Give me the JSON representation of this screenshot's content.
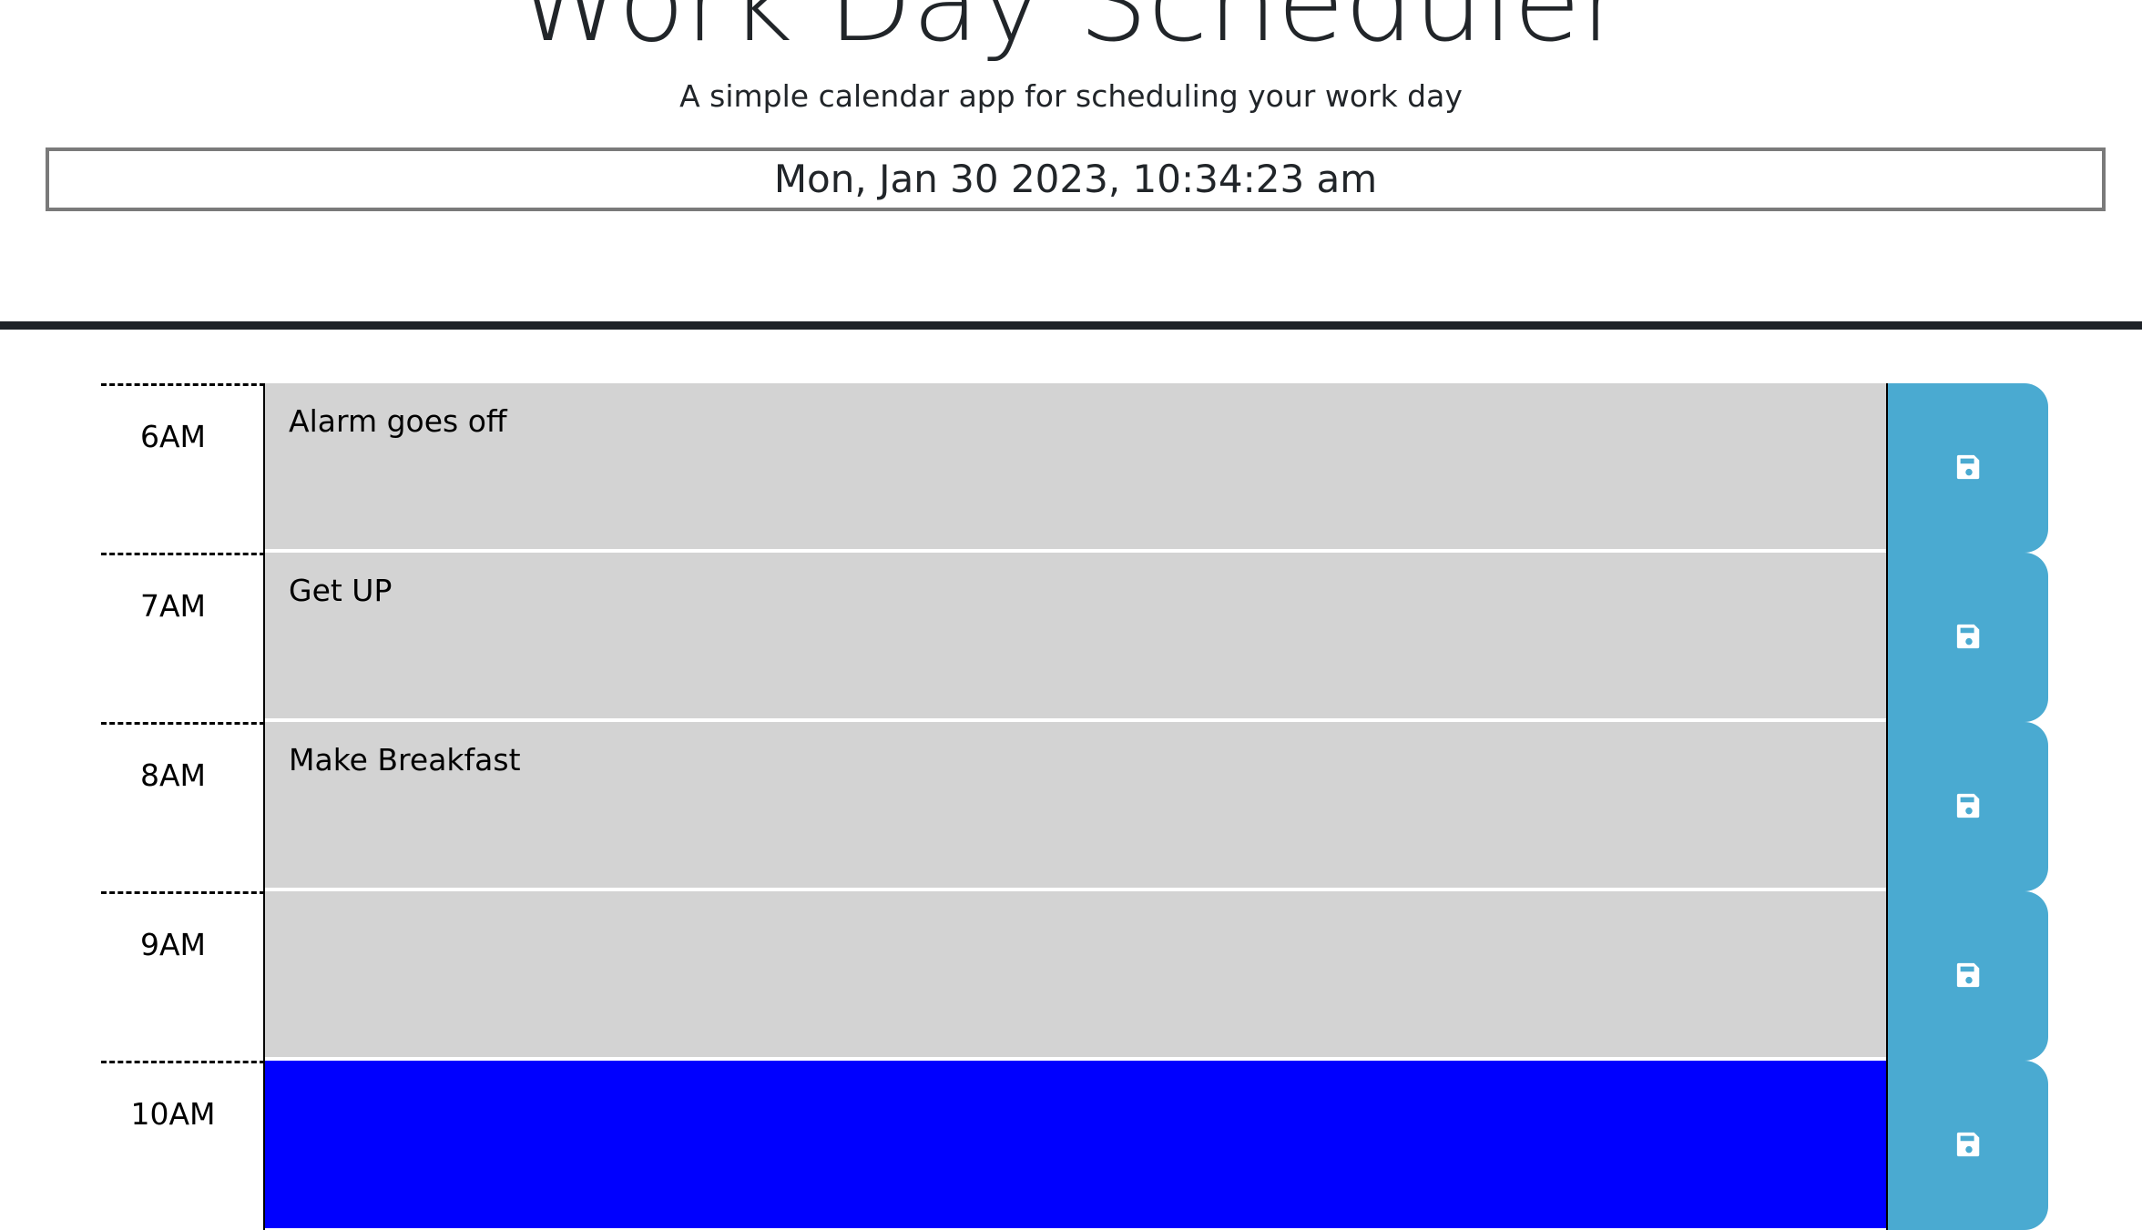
{
  "header": {
    "title": "Work Day Scheduler",
    "subtitle": "A simple calendar app for scheduling your work day",
    "current_datetime": "Mon, Jan 30 2023, 10:34:23 am"
  },
  "colors": {
    "past": "#d3d3d3",
    "present": "#0000ff",
    "save_button": "#4aaad1"
  },
  "rows": [
    {
      "hour": "6AM",
      "text": "Alarm goes off",
      "state": "past",
      "icon": "save-icon"
    },
    {
      "hour": "7AM",
      "text": "Get UP",
      "state": "past",
      "icon": "save-icon"
    },
    {
      "hour": "8AM",
      "text": "Make Breakfast",
      "state": "past",
      "icon": "save-icon"
    },
    {
      "hour": "9AM",
      "text": "",
      "state": "past",
      "icon": "save-icon"
    },
    {
      "hour": "10AM",
      "text": "",
      "state": "present",
      "icon": "save-icon"
    }
  ]
}
